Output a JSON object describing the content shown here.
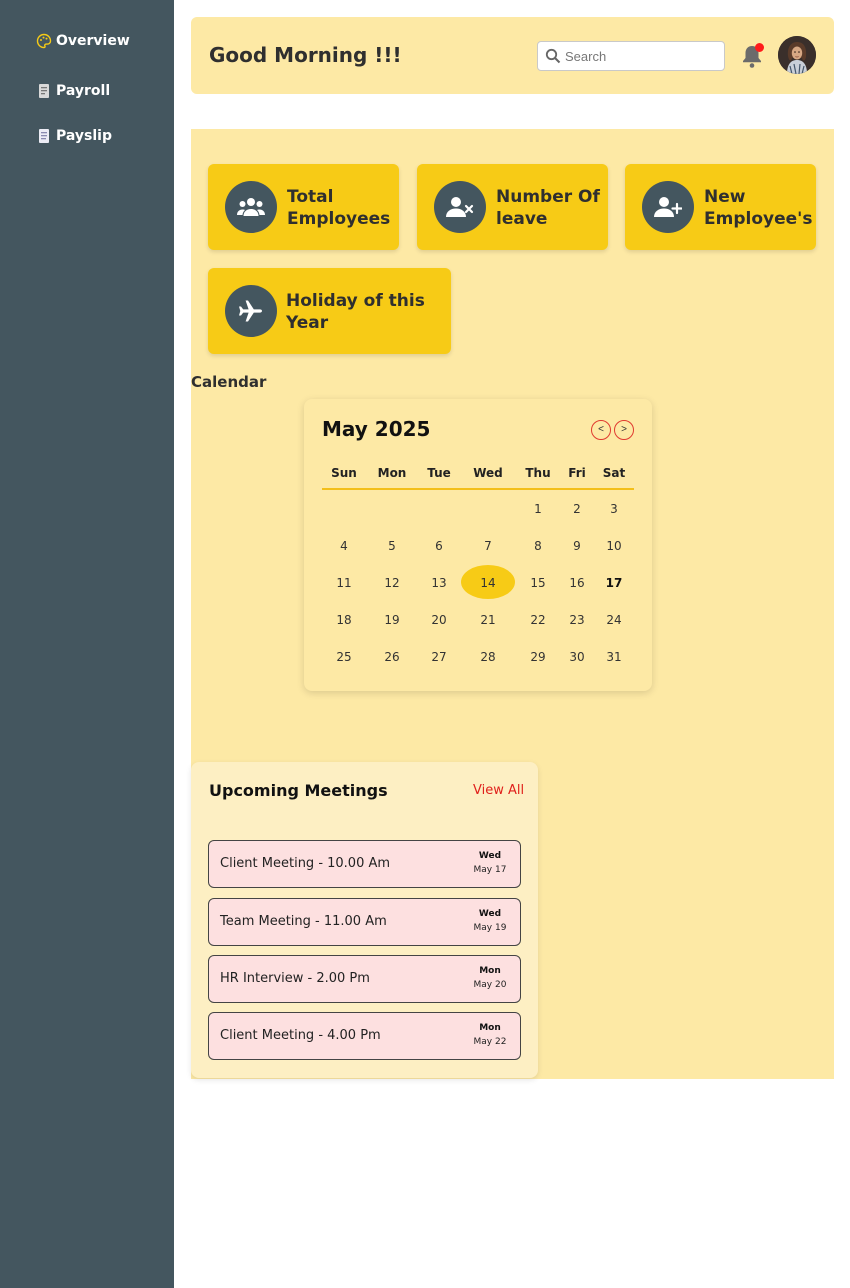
{
  "sidebar": {
    "items": [
      {
        "label": "Overview",
        "icon": "palette-icon"
      },
      {
        "label": "Payroll",
        "icon": "document-icon"
      },
      {
        "label": "Payslip",
        "icon": "receipt-icon"
      }
    ]
  },
  "header": {
    "greeting": "Good Morning !!!",
    "search_placeholder": "Search",
    "notification_dot": true
  },
  "stats": [
    {
      "label_line1": "Total",
      "label_line2": "Employees",
      "icon": "users-icon"
    },
    {
      "label_line1": "Number Of",
      "label_line2": "leave",
      "icon": "user-remove-icon"
    },
    {
      "label_line1": "New",
      "label_line2": "Employee's",
      "icon": "user-add-icon"
    },
    {
      "label_line1": "Holiday of this",
      "label_line2": "Year",
      "icon": "airplane-icon"
    }
  ],
  "calendar": {
    "heading": "Calendar",
    "month_label": "May 2025",
    "prev_label": "<",
    "next_label": ">",
    "weekdays": [
      "Sun",
      "Mon",
      "Tue",
      "Wed",
      "Thu",
      "Fri",
      "Sat"
    ],
    "first_weekday_index": 4,
    "days_in_month": 31,
    "today": 17
  },
  "meetings": {
    "title": "Upcoming Meetings",
    "view_all": "View All",
    "items": [
      {
        "name": "Client Meeting - 10.00 Am",
        "weekday": "Wed",
        "date": "May 17"
      },
      {
        "name": "Team Meeting - 11.00 Am",
        "weekday": "Wed",
        "date": "May 19"
      },
      {
        "name": "HR Interview - 2.00 Pm",
        "weekday": "Mon",
        "date": "May 20"
      },
      {
        "name": "Client Meeting - 4.00 Pm",
        "weekday": "Mon",
        "date": "May 22"
      }
    ]
  },
  "colors": {
    "sidebar": "#44565f",
    "panel": "#fde9a5",
    "card": "#f7cb16",
    "accent_red": "#e0201b",
    "meeting_bg": "#fde0e0"
  }
}
